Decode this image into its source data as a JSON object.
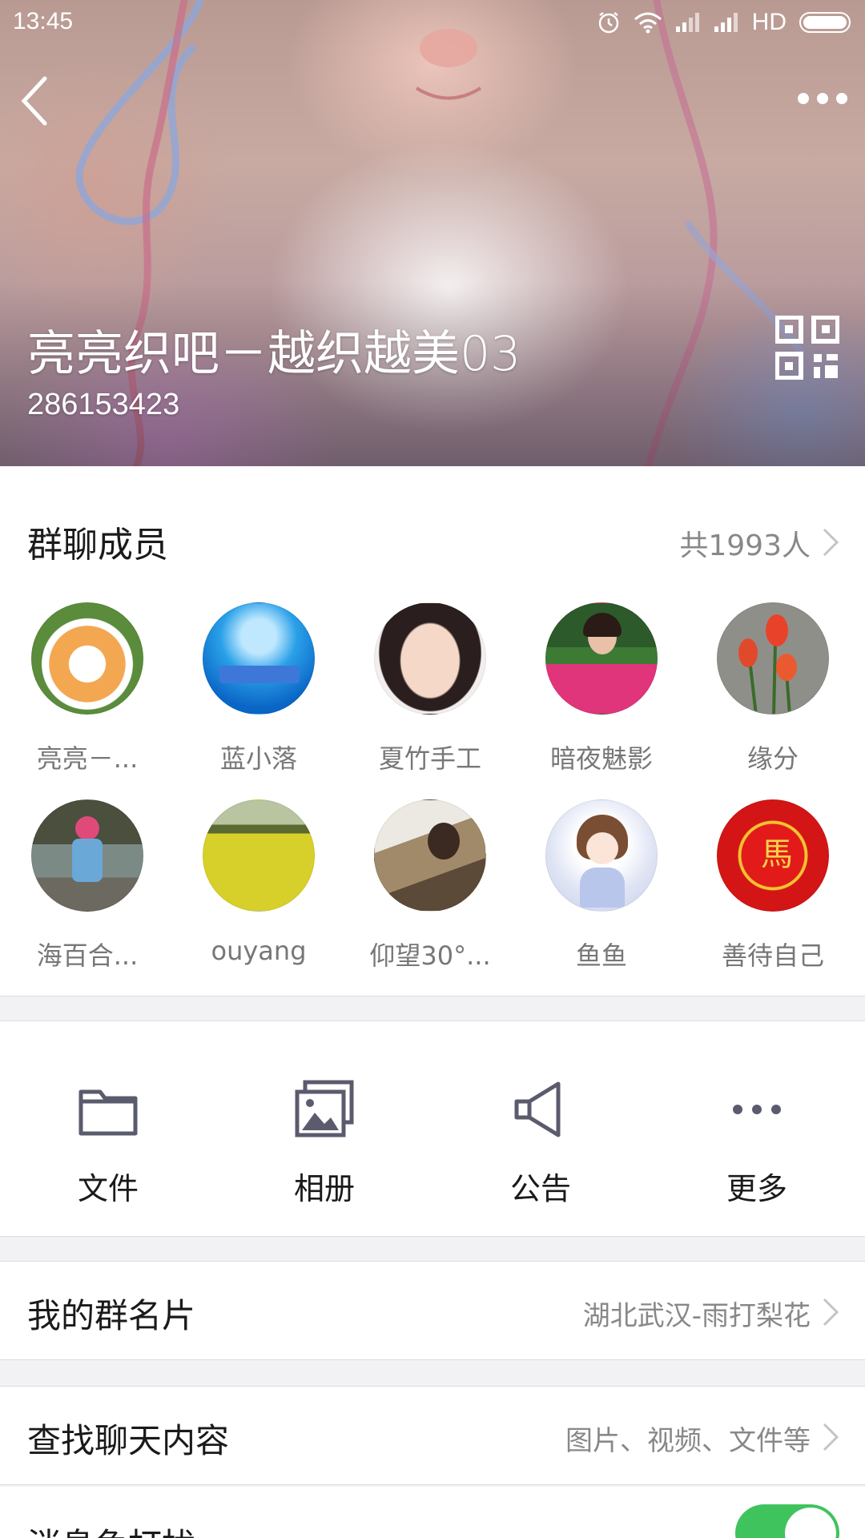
{
  "status_bar": {
    "time": "13:45",
    "network_label": "HD",
    "icons": [
      "alarm-icon",
      "wifi-icon",
      "signal-icon",
      "signal-icon",
      "battery-icon"
    ]
  },
  "header": {
    "group_name": "亮亮织吧－越织越美03",
    "group_number": "286153423"
  },
  "members": {
    "title": "群聊成员",
    "count_label": "共1993人",
    "list": [
      {
        "name": "亮亮－..."
      },
      {
        "name": "蓝小落"
      },
      {
        "name": "夏竹手工"
      },
      {
        "name": "暗夜魅影"
      },
      {
        "name": "缘分"
      },
      {
        "name": "海百合..."
      },
      {
        "name": "ouyang"
      },
      {
        "name": "仰望30°..."
      },
      {
        "name": "鱼鱼"
      },
      {
        "name": "善待自己"
      }
    ]
  },
  "actions": [
    {
      "label": "文件",
      "icon": "folder-icon"
    },
    {
      "label": "相册",
      "icon": "album-icon"
    },
    {
      "label": "公告",
      "icon": "megaphone-icon"
    },
    {
      "label": "更多",
      "icon": "more-icon"
    }
  ],
  "rows": {
    "card": {
      "label": "我的群名片",
      "value": "湖北武汉-雨打梨花"
    },
    "search": {
      "label": "查找聊天内容",
      "value": "图片、视频、文件等"
    },
    "dnd": {
      "label": "消息免打扰",
      "enabled": true
    }
  },
  "colors": {
    "toggle_on": "#3fc35d",
    "icon_gray": "#5b5b6e"
  }
}
